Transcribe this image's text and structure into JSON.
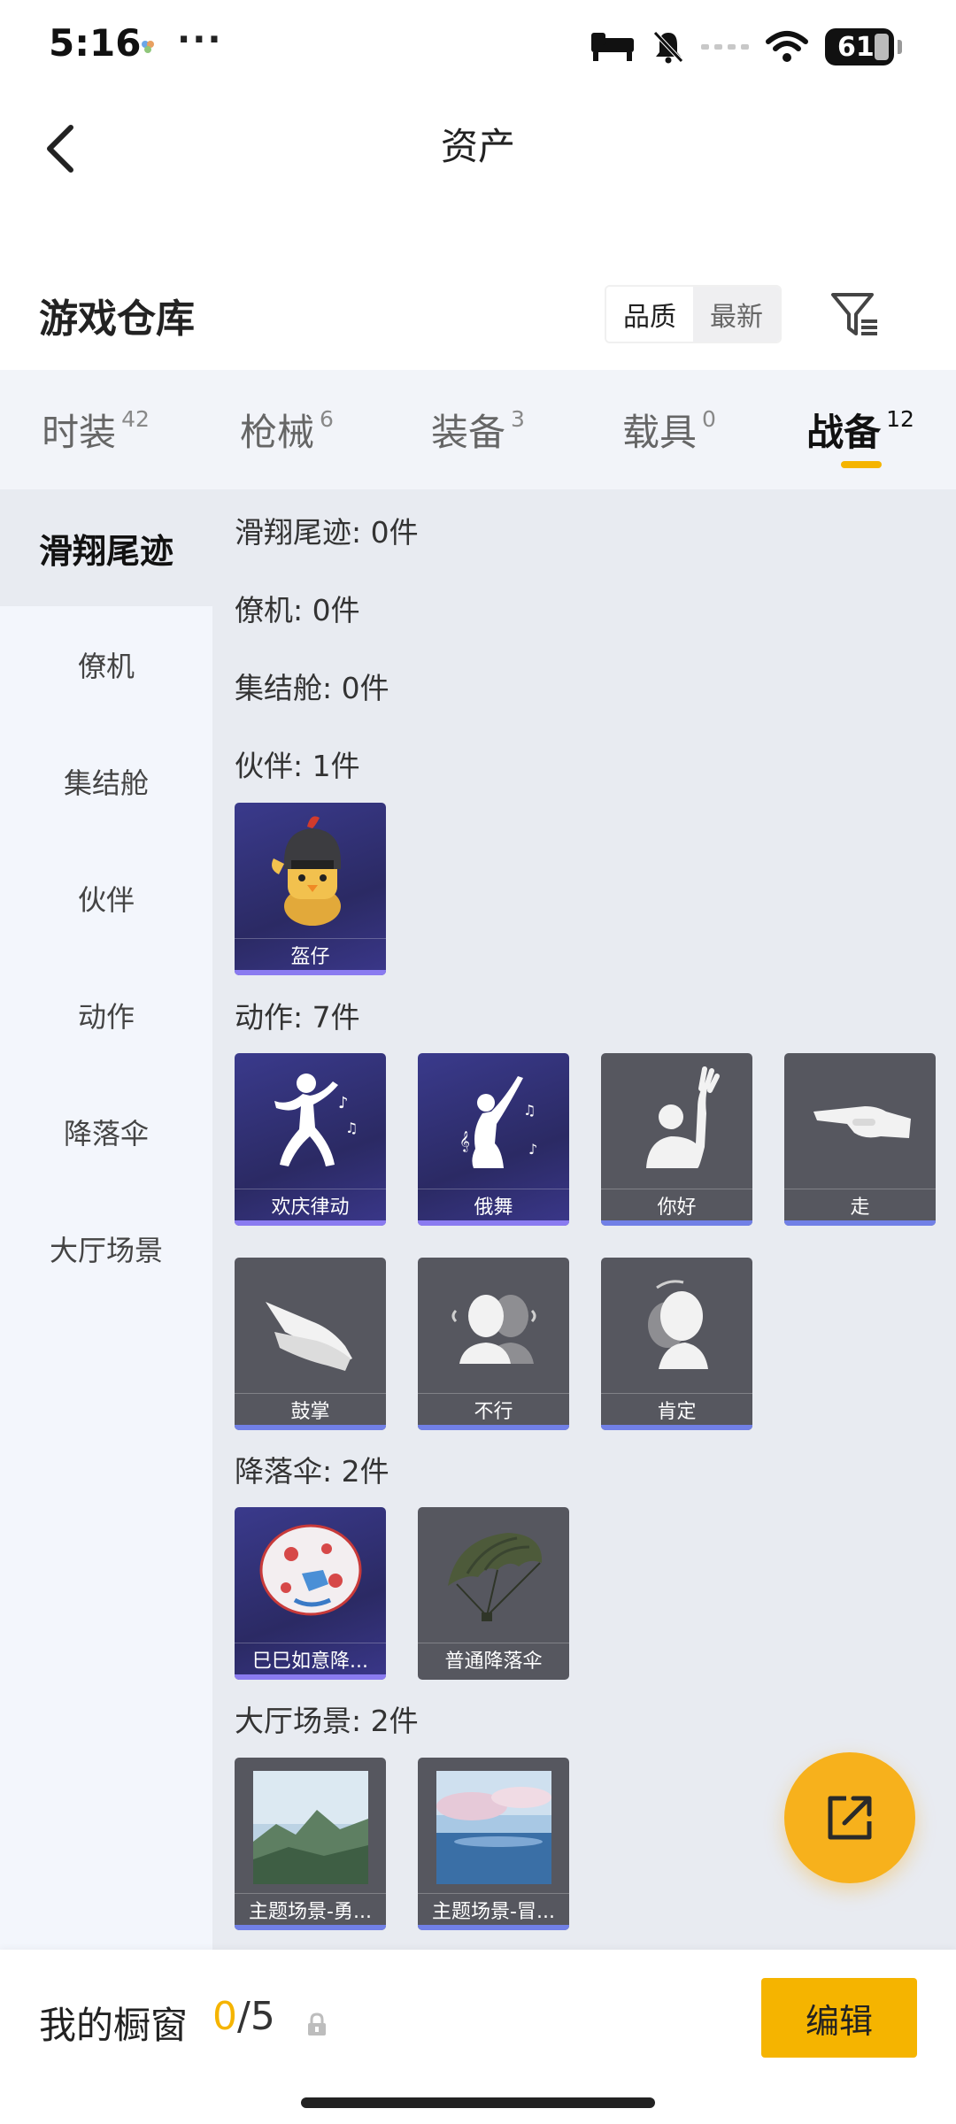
{
  "status_bar": {
    "time": "5:16",
    "more": "···",
    "battery": "61"
  },
  "nav": {
    "title": "资产"
  },
  "section": {
    "title": "游戏仓库",
    "sort_options": [
      "品质",
      "最新"
    ],
    "active_sort": "品质"
  },
  "category_tabs": [
    {
      "label": "时装",
      "count": "42"
    },
    {
      "label": "枪械",
      "count": "6"
    },
    {
      "label": "装备",
      "count": "3"
    },
    {
      "label": "载具",
      "count": "0"
    },
    {
      "label": "战备",
      "count": "12"
    }
  ],
  "active_tab": "战备",
  "sidebar": {
    "items": [
      "滑翔尾迹",
      "僚机",
      "集结舱",
      "伙伴",
      "动作",
      "降落伞",
      "大厅场景"
    ],
    "active": "滑翔尾迹"
  },
  "groups": {
    "glide": {
      "title": "滑翔尾迹: 0件"
    },
    "wingman": {
      "title": "僚机: 0件"
    },
    "pod": {
      "title": "集结舱: 0件"
    },
    "partner": {
      "title": "伙伴: 1件",
      "items": [
        {
          "name": "盔仔",
          "icon": "helmet-chick-icon",
          "rarity": "epic"
        }
      ]
    },
    "emote": {
      "title": "动作: 7件",
      "items": [
        {
          "name": "欢庆律动",
          "icon": "dance-icon",
          "rarity": "epic"
        },
        {
          "name": "俄舞",
          "icon": "ballet-icon",
          "rarity": "epic"
        },
        {
          "name": "你好",
          "icon": "wave-icon",
          "rarity": "common"
        },
        {
          "name": "走",
          "icon": "pointing-hand-icon",
          "rarity": "common"
        },
        {
          "name": "鼓掌",
          "icon": "clap-icon",
          "rarity": "common"
        },
        {
          "name": "不行",
          "icon": "shake-head-icon",
          "rarity": "common"
        },
        {
          "name": "肯定",
          "icon": "nod-icon",
          "rarity": "common"
        }
      ]
    },
    "parachute": {
      "title": "降落伞: 2件",
      "items": [
        {
          "name": "巳巳如意降...",
          "icon": "decorated-parachute-icon",
          "rarity": "epic"
        },
        {
          "name": "普通降落伞",
          "icon": "green-parachute-icon",
          "rarity": "common"
        }
      ]
    },
    "lobby": {
      "title": "大厅场景: 2件",
      "items": [
        {
          "name": "主题场景-勇...",
          "icon": "mountain-scene-icon",
          "rarity": "common"
        },
        {
          "name": "主题场景-冒...",
          "icon": "ocean-scene-icon",
          "rarity": "common"
        }
      ]
    }
  },
  "showcase": {
    "label": "我的橱窗",
    "used": "0",
    "separator": "/",
    "total": "5",
    "edit_label": "编辑"
  },
  "colors": {
    "accent": "#f5b400",
    "content_bg": "#e8ebf1",
    "sidebar_bg": "#f3f6fc",
    "epic": "#2b2a64",
    "common": "#56575f",
    "rarity_bar": "#7180e6"
  }
}
